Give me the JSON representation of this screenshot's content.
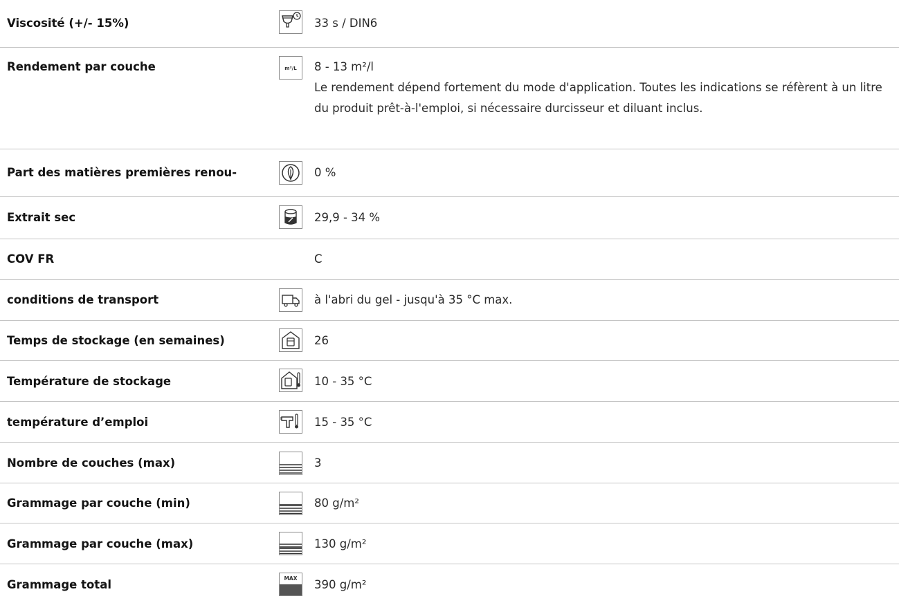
{
  "rows": [
    {
      "label": "Viscosité (+/- 15%)",
      "icon": "viscosity-cup-timer-icon",
      "value": "33 s / DIN6"
    },
    {
      "label": "Rendement par couche",
      "icon": "m2-per-litre-icon",
      "icon_text": "m²/L",
      "value": "8 - 13 m²/l",
      "note": "Le rendement dépend fortement du mode d'application. Toutes les indications se réfèrent à un litre du produit prêt-à-l'emploi, si nécessaire durcisseur et diluant in­clus."
    },
    {
      "label": "Part des matières premières renou-",
      "icon": "renewable-leaf-icon",
      "value": "0 %"
    },
    {
      "label": "Extrait sec",
      "icon": "solid-content-can-icon",
      "value": "29,9 - 34 %"
    },
    {
      "label": "COV FR",
      "icon": "",
      "value": "C"
    },
    {
      "label": "conditions de transport",
      "icon": "transport-truck-icon",
      "value": "à l'abri du gel - jusqu'à 35 °C max."
    },
    {
      "label": "Temps de stockage (en semaines)",
      "icon": "storage-house-can-icon",
      "value": "26"
    },
    {
      "label": "Température de stockage",
      "icon": "storage-temperature-icon",
      "value": "10 - 35 °C"
    },
    {
      "label": "température d’emploi",
      "icon": "application-temperature-spraygun-icon",
      "value": "15 - 35 °C"
    },
    {
      "label": "Nombre de couches (max)",
      "icon": "layers-count-icon",
      "value": "3"
    },
    {
      "label": "Grammage par couche (min)",
      "icon": "layer-weight-min-icon",
      "value": "80 g/m²"
    },
    {
      "label": "Grammage par couche (max)",
      "icon": "layer-weight-max-icon",
      "value": "130 g/m²"
    },
    {
      "label": "Grammage total",
      "icon": "total-weight-max-icon",
      "icon_text": "MAX",
      "value": "390 g/m²"
    }
  ]
}
